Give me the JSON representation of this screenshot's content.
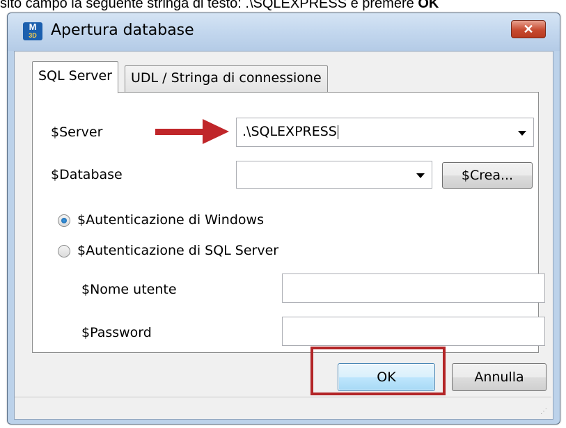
{
  "doc_line": {
    "prefix": "sito campo la seguente stringa di testo: .\\SQLEXPRESS e premere ",
    "bold_suffix": "OK"
  },
  "window": {
    "title": "Apertura database",
    "icon_label": "M",
    "icon_sub": "3D",
    "close_symbol": "✕"
  },
  "tabs": [
    {
      "label": "SQL Server"
    },
    {
      "label": "UDL / Stringa di connessione"
    }
  ],
  "server": {
    "label": "$Server",
    "value": ".\\SQLEXPRESS"
  },
  "database": {
    "label": "$Database",
    "value": "",
    "create_label": "$Crea..."
  },
  "auth": {
    "windows_label": "$Autenticazione di Windows",
    "sql_label": "$Autenticazione di SQL Server",
    "selected": "windows"
  },
  "credentials": {
    "user_label": "$Nome utente",
    "user_value": "",
    "password_label": "$Password",
    "password_value": ""
  },
  "buttons": {
    "ok": "OK",
    "cancel": "Annulla"
  },
  "colors": {
    "arrow": "#c0262a",
    "highlight": "#b32527"
  }
}
